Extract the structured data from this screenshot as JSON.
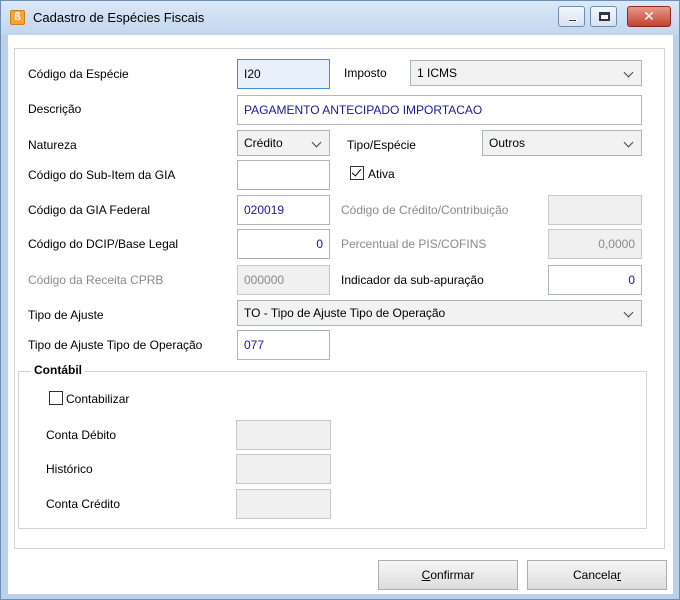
{
  "window": {
    "title": "Cadastro de Espécies Fiscais",
    "icon": "app-logo-icon",
    "controls": [
      "minimize-icon",
      "maximize-icon",
      "close-icon"
    ]
  },
  "form": {
    "codigo_especie": {
      "label": "Código da Espécie",
      "value": "I20"
    },
    "imposto": {
      "label": "Imposto",
      "value": "1 ICMS"
    },
    "descricao": {
      "label": "Descrição",
      "value": "PAGAMENTO ANTECIPADO IMPORTACAO"
    },
    "natureza": {
      "label": "Natureza",
      "value": "Crédito"
    },
    "tipo_especie": {
      "label": "Tipo/Espécie",
      "value": "Outros"
    },
    "sub_item_gia": {
      "label": "Código do Sub-Item da GIA",
      "value": ""
    },
    "ativa": {
      "label": "Ativa",
      "checked": true
    },
    "gia_federal": {
      "label": "Código da GIA Federal",
      "value": "020019"
    },
    "credito_contribuicao": {
      "label": "Código de Crédito/Contribuição",
      "value": ""
    },
    "dcip_base_legal": {
      "label": "Código do DCIP/Base Legal",
      "value": "0"
    },
    "percentual_pis_cofins": {
      "label": "Percentual de PIS/COFINS",
      "value": "0,0000"
    },
    "receita_cprb": {
      "label": "Código da Receita CPRB",
      "value": "000000"
    },
    "indicador_subapuracao": {
      "label": "Indicador da sub-apuração",
      "value": "0"
    },
    "tipo_ajuste": {
      "label": "Tipo de Ajuste",
      "value": "TO - Tipo de Ajuste Tipo de Operação"
    },
    "tipo_ajuste_operacao": {
      "label": "Tipo de Ajuste Tipo de Operação",
      "value": "077"
    }
  },
  "contabil": {
    "title": "Contábil",
    "contabilizar": {
      "label": "Contabilizar",
      "checked": false
    },
    "conta_debito": {
      "label": "Conta Débito",
      "value": ""
    },
    "historico": {
      "label": "Histórico",
      "value": ""
    },
    "conta_credito": {
      "label": "Conta Crédito",
      "value": ""
    }
  },
  "buttons": {
    "confirmar": {
      "pre": "",
      "u": "C",
      "post": "onfirmar"
    },
    "cancelar": {
      "pre": "Cancela",
      "u": "r",
      "post": ""
    }
  }
}
